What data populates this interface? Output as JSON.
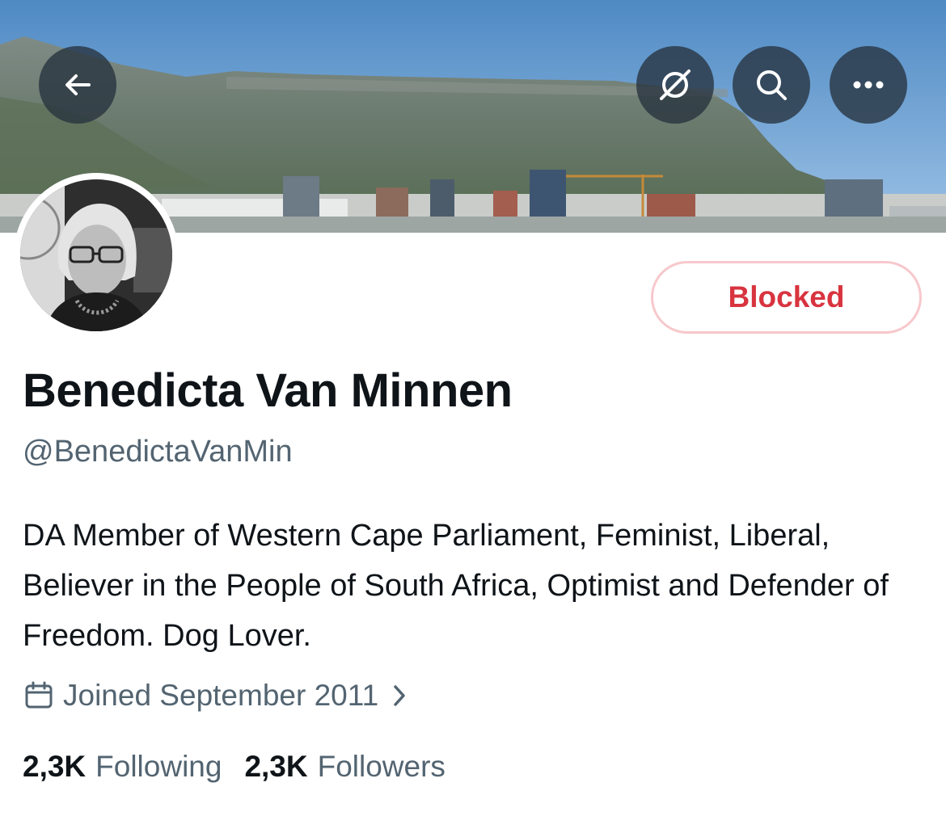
{
  "profile": {
    "name": "Benedicta Van Minnen",
    "handle": "@BenedictaVanMin",
    "bio": "DA Member of Western Cape Parliament, Feminist, Liberal, Believer in the People of South Africa, Optimist and Defender of Freedom. Dog Lover.",
    "joined": "Joined September 2011",
    "following_count": "2,3K",
    "following_label": "Following",
    "followers_count": "2,3K",
    "followers_label": "Followers"
  },
  "actions": {
    "blocked_label": "Blocked"
  },
  "icons": {
    "back": "arrow-left-icon",
    "grok": "grok-icon",
    "search": "search-icon",
    "more": "more-horizontal-icon",
    "calendar": "calendar-icon",
    "chevron": "chevron-right-icon"
  },
  "colors": {
    "blocked_text": "#d8343f",
    "blocked_border": "#f7c8cc",
    "primary_text": "#0f1419",
    "secondary_text": "#536471"
  }
}
